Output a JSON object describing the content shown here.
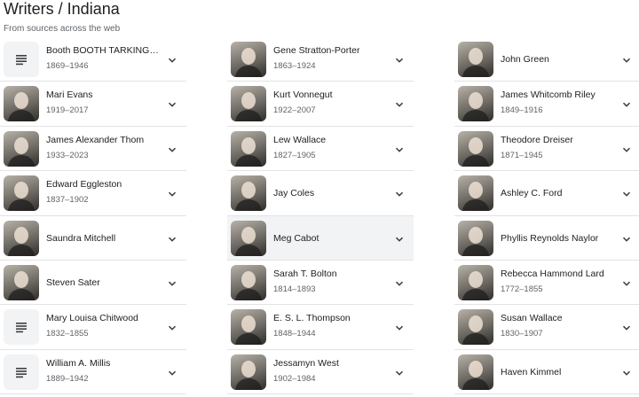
{
  "header": {
    "title": "Writers / Indiana",
    "subtitle": "From sources across the web"
  },
  "columns": [
    [
      {
        "name": "Booth BOOTH TARKINGTON",
        "years": "1869–1946",
        "thumb": "list-icon"
      },
      {
        "name": "Mari Evans",
        "years": "1919–2017",
        "thumb": "photo"
      },
      {
        "name": "James Alexander Thom",
        "years": "1933–2023",
        "thumb": "photo"
      },
      {
        "name": "Edward Eggleston",
        "years": "1837–1902",
        "thumb": "photo"
      },
      {
        "name": "Saundra Mitchell",
        "years": "",
        "thumb": "photo"
      },
      {
        "name": "Steven Sater",
        "years": "",
        "thumb": "photo"
      },
      {
        "name": "Mary Louisa Chitwood",
        "years": "1832–1855",
        "thumb": "list-icon"
      },
      {
        "name": "William A. Millis",
        "years": "1889–1942",
        "thumb": "list-icon"
      }
    ],
    [
      {
        "name": "Gene Stratton-Porter",
        "years": "1863–1924",
        "thumb": "photo"
      },
      {
        "name": "Kurt Vonnegut",
        "years": "1922–2007",
        "thumb": "photo"
      },
      {
        "name": "Lew Wallace",
        "years": "1827–1905",
        "thumb": "photo"
      },
      {
        "name": "Jay Coles",
        "years": "",
        "thumb": "photo"
      },
      {
        "name": "Meg Cabot",
        "years": "",
        "thumb": "photo",
        "active": true
      },
      {
        "name": "Sarah T. Bolton",
        "years": "1814–1893",
        "thumb": "photo"
      },
      {
        "name": "E. S. L. Thompson",
        "years": "1848–1944",
        "thumb": "photo"
      },
      {
        "name": "Jessamyn West",
        "years": "1902–1984",
        "thumb": "photo"
      }
    ],
    [
      {
        "name": "John Green",
        "years": "",
        "thumb": "photo"
      },
      {
        "name": "James Whitcomb Riley",
        "years": "1849–1916",
        "thumb": "photo"
      },
      {
        "name": "Theodore Dreiser",
        "years": "1871–1945",
        "thumb": "photo"
      },
      {
        "name": "Ashley C. Ford",
        "years": "",
        "thumb": "photo"
      },
      {
        "name": "Phyllis Reynolds Naylor",
        "years": "",
        "thumb": "photo"
      },
      {
        "name": "Rebecca Hammond Lard",
        "years": "1772–1855",
        "thumb": "photo"
      },
      {
        "name": "Susan Wallace",
        "years": "1830–1907",
        "thumb": "photo"
      },
      {
        "name": "Haven Kimmel",
        "years": "",
        "thumb": "photo"
      }
    ]
  ],
  "icons": {
    "expand": "chevron-down-icon",
    "placeholder": "list-icon"
  },
  "colors": {
    "divider": "#e3e3e3",
    "active_row": "#f1f3f4",
    "secondary_text": "#5f6368"
  }
}
